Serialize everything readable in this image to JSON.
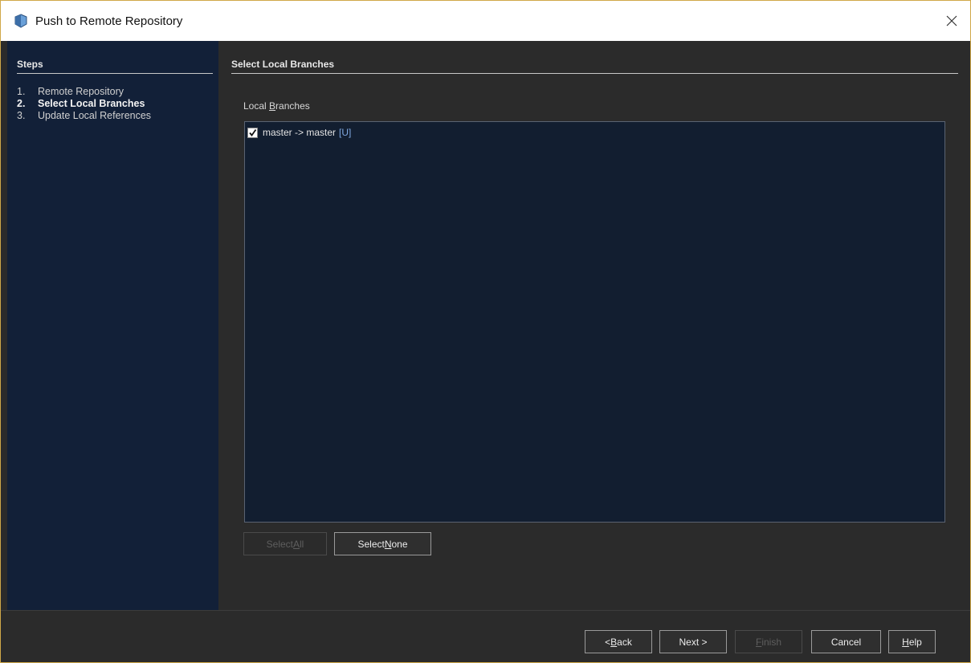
{
  "window": {
    "title": "Push to Remote Repository"
  },
  "steps": {
    "heading": "Steps",
    "items": [
      {
        "num": "1.",
        "label": "Remote Repository",
        "active": false
      },
      {
        "num": "2.",
        "label": "Select Local Branches",
        "active": true
      },
      {
        "num": "3.",
        "label": "Update Local References",
        "active": false
      }
    ]
  },
  "content": {
    "heading": "Select Local Branches",
    "list_label_pre": "Local ",
    "list_label_mnemonic": "B",
    "list_label_post": "ranches",
    "branches": [
      {
        "name": "master -> master",
        "tag": "[U]",
        "checked": true
      }
    ],
    "select_all": {
      "pre": "Select ",
      "mn": "A",
      "post": "ll",
      "enabled": false
    },
    "select_none": {
      "pre": "Select ",
      "mn": "N",
      "post": "one",
      "enabled": true
    }
  },
  "footer": {
    "back": {
      "pre": "< ",
      "mn": "B",
      "post": "ack",
      "enabled": true
    },
    "next": {
      "pre": "Next >",
      "mn": "",
      "post": "",
      "enabled": true
    },
    "finish": {
      "pre": "",
      "mn": "F",
      "post": "inish",
      "enabled": false
    },
    "cancel": {
      "pre": "Cancel",
      "mn": "",
      "post": "",
      "enabled": true
    },
    "help": {
      "pre": "",
      "mn": "H",
      "post": "elp",
      "enabled": true
    }
  },
  "icons": {
    "app": "app-shield-icon",
    "close": "close-icon",
    "check": "check-icon"
  },
  "colors": {
    "steps_panel": "#122038",
    "list_bg": "#121e30",
    "tag": "#7fa7e0"
  }
}
